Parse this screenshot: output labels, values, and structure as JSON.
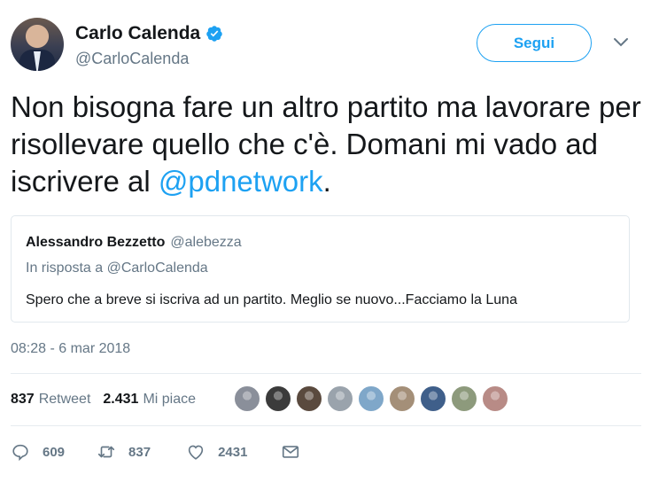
{
  "author": {
    "display_name": "Carlo Calenda",
    "handle": "@CarloCalenda",
    "verified": true
  },
  "follow_button": {
    "label": "Segui"
  },
  "tweet": {
    "text_before": "Non bisogna fare un altro partito ma lavorare per risollevare quello che c'è. Domani mi vado ad iscrivere al ",
    "mention": "@pdnetwork",
    "text_after": "."
  },
  "quoted_tweet": {
    "display_name": "Alessandro Bezzetto",
    "handle": "@alebezza",
    "reply_to": "In risposta a @CarloCalenda",
    "text": "Spero che a breve si iscriva ad un partito. Meglio se nuovo...Facciamo la Luna"
  },
  "timestamp": "08:28 - 6 mar 2018",
  "stats": {
    "retweets_count": "837",
    "retweets_label": "Retweet",
    "likes_count": "2.431",
    "likes_label": "Mi piace"
  },
  "liker_avatars": [
    {
      "name": "liker-1",
      "color": "#8a8f9a"
    },
    {
      "name": "liker-2",
      "color": "#3b3b3b"
    },
    {
      "name": "liker-3",
      "color": "#5a4a3e"
    },
    {
      "name": "liker-4",
      "color": "#9aa3ac"
    },
    {
      "name": "liker-5",
      "color": "#7fa7c9"
    },
    {
      "name": "liker-6",
      "color": "#a48f78"
    },
    {
      "name": "liker-7",
      "color": "#3f5f8a"
    },
    {
      "name": "liker-8",
      "color": "#8d9a7c"
    },
    {
      "name": "liker-9",
      "color": "#b88b86"
    }
  ],
  "actions": {
    "reply_count": "609",
    "retweet_count": "837",
    "like_count": "2431"
  },
  "colors": {
    "accent": "#1da1f2",
    "text": "#14171a",
    "muted": "#657786"
  }
}
